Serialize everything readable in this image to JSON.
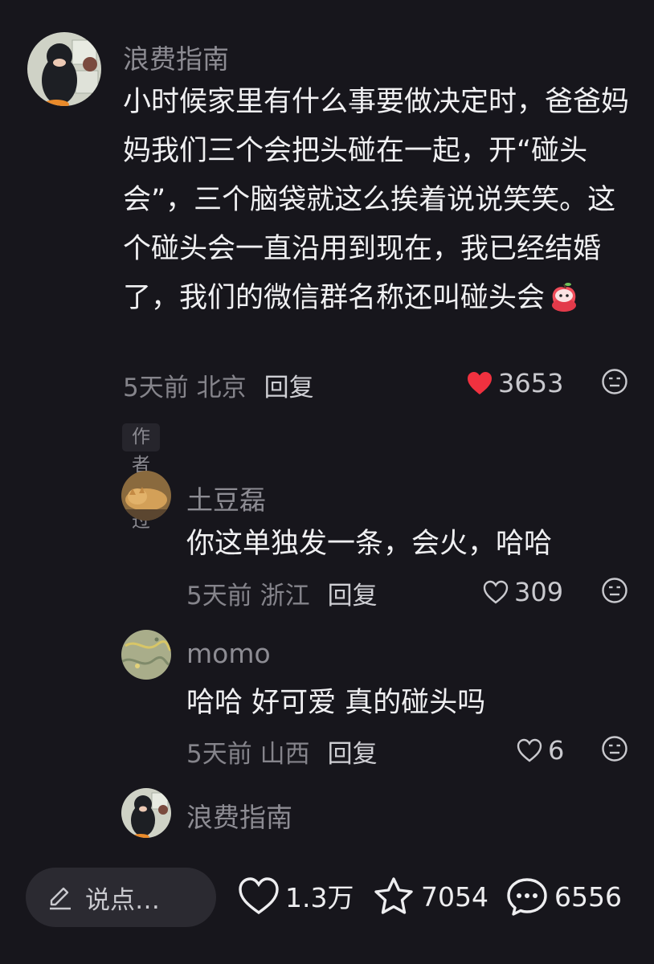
{
  "comments": [
    {
      "username": "浪费指南",
      "text": "小时候家里有什么事要做决定时，爸爸妈妈我们三个会把头碰在一起，开“碰头会”，三个脑袋就这么挨着说说笑笑。这个碰头会一直沿用到现在，我已经结婚了，我们的微信群名称还叫碰头会",
      "time_location": "5天前 北京",
      "reply_label": "回复",
      "likes": "3653",
      "liked": true,
      "badge": "作者赞过",
      "emoji": "apple-mascot-emoji"
    }
  ],
  "replies": [
    {
      "username": "土豆磊",
      "text": "你这单独发一条，会火，哈哈",
      "time_location": "5天前 浙江",
      "reply_label": "回复",
      "likes": "309"
    },
    {
      "username": "momo",
      "text": "哈哈 好可爱 真的碰头吗",
      "time_location": "5天前 山西",
      "reply_label": "回复",
      "likes": "6"
    },
    {
      "username": "浪费指南"
    }
  ],
  "bottom_bar": {
    "input_placeholder": "说点…",
    "likes": "1.3万",
    "favorites": "7054",
    "comments": "6556"
  },
  "colors": {
    "like_red": "#f0313f",
    "background": "#17161c"
  }
}
